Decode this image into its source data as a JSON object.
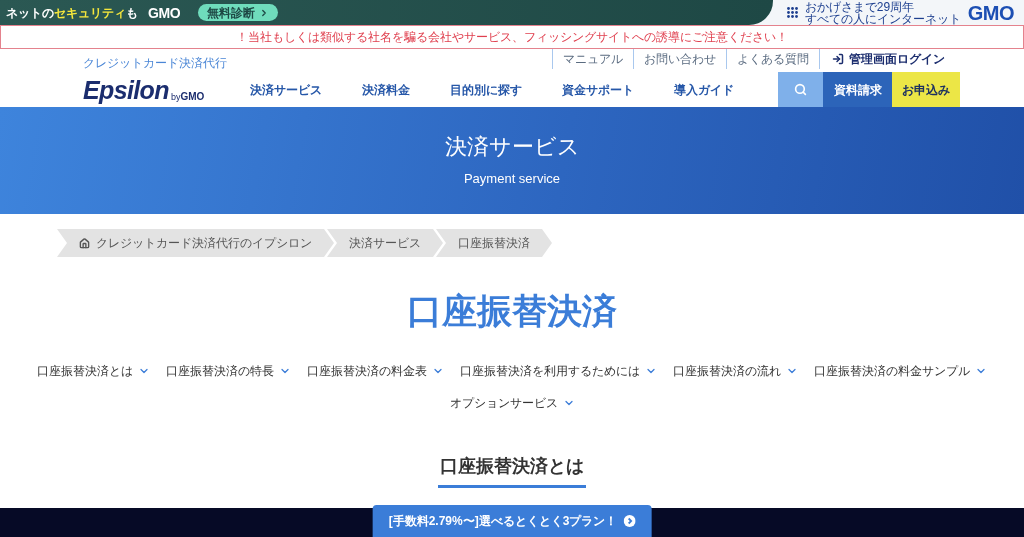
{
  "top_bar": {
    "promo": {
      "prefix": "ネットの",
      "highlight": "セキュリティ",
      "suffix": "も"
    },
    "logo": "GMO",
    "cta": {
      "label": "無料診断"
    },
    "tagline": [
      "おかげさまで29周年",
      "すべての人にインターネット"
    ],
    "brand": "GMO"
  },
  "alert": {
    "text": "！当社もしくは類似する社名を騙る会社やサービス、フィッシングサイトへの誘導にご注意ください！"
  },
  "header": {
    "tagline": "クレジットカード決済代行",
    "logo": {
      "name": "Epsilon",
      "by": "by",
      "brand": "GMO"
    },
    "utility_links": [
      "マニュアル",
      "お問い合わせ",
      "よくある質問"
    ],
    "login": {
      "label": "管理画面ログイン"
    },
    "nav": [
      "決済サービス",
      "決済料金",
      "目的別に探す",
      "資金サポート",
      "導入ガイド"
    ],
    "actions": [
      {
        "kind": "search"
      },
      {
        "kind": "primary",
        "label": "資料請求"
      },
      {
        "kind": "accent",
        "label": "お申込み"
      }
    ]
  },
  "hero": {
    "title": "決済サービス",
    "subtitle": "Payment service"
  },
  "breadcrumb": [
    {
      "kind": "home",
      "label": "クレジットカード決済代行のイプシロン"
    },
    {
      "kind": "page",
      "label": "決済サービス"
    },
    {
      "kind": "page",
      "label": "口座振替決済"
    }
  ],
  "page_title": "口座振替決済",
  "anchor_links": [
    "口座振替決済とは",
    "口座振替決済の特長",
    "口座振替決済の料金表",
    "口座振替決済を利用するためには",
    "口座振替決済の流れ",
    "口座振替決済の料金サンプル",
    "オプションサービス"
  ],
  "section": {
    "heading": "口座振替決済とは"
  },
  "bottom_bar": {
    "button": {
      "label": "[手数料2.79%〜]選べるとくとく3プラン！"
    }
  }
}
